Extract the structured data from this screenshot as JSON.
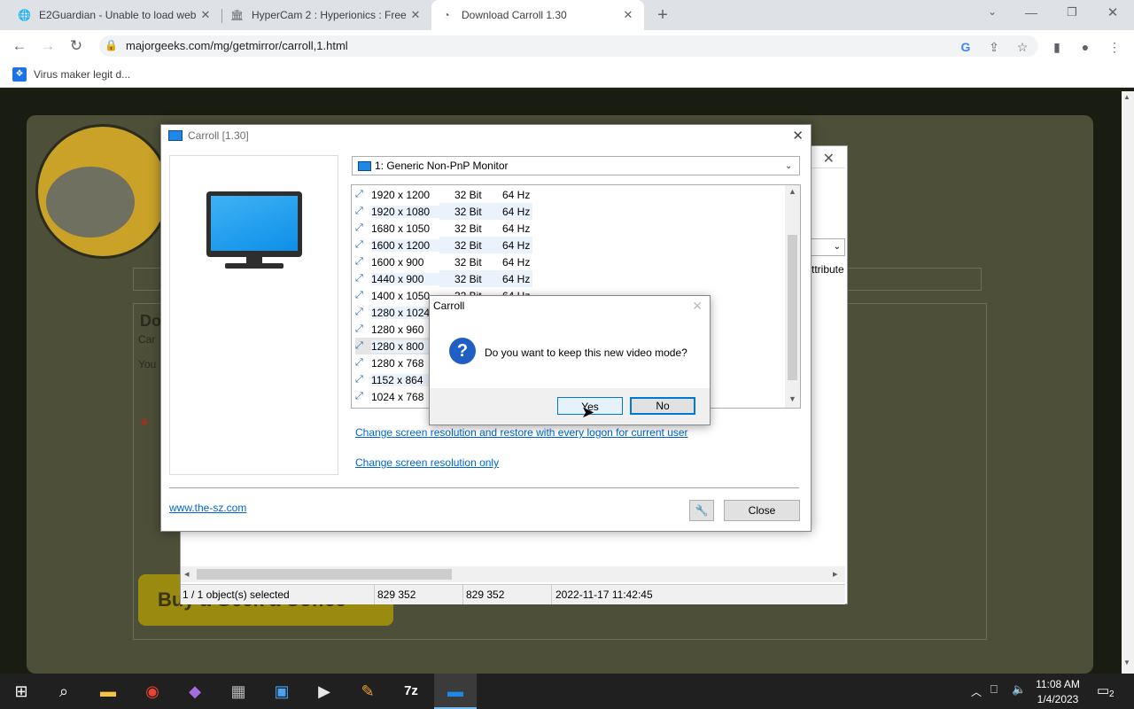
{
  "browser": {
    "tabs": [
      {
        "title": "E2Guardian - Unable to load web",
        "icon": "globe-icon"
      },
      {
        "title": "HyperCam 2 : Hyperionics : Free",
        "icon": "library-icon"
      },
      {
        "title": "Download Carroll 1.30",
        "icon": "spinner-icon"
      }
    ],
    "url": "majorgeeks.com/mg/getmirror/carroll,1.html",
    "bookmark": "Virus maker legit d..."
  },
  "bg_window": {
    "status_selected": "1 / 1 object(s) selected",
    "size1": "829 352",
    "size2": "829 352",
    "date": "2022-11-17 11:42:45",
    "partial_text": "ttribute"
  },
  "page": {
    "partial_heading": "Do",
    "partial_sub": "Car",
    "partial_text": "You",
    "coffee": "Buy a Geek a Coffee"
  },
  "carroll": {
    "title": "Carroll [1.30]",
    "monitor": "1: Generic Non-PnP Monitor",
    "modes": [
      {
        "res": "1920 x 1200",
        "bits": "32 Bit",
        "hz": "64 Hz"
      },
      {
        "res": "1920 x 1080",
        "bits": "32 Bit",
        "hz": "64 Hz"
      },
      {
        "res": "1680 x 1050",
        "bits": "32 Bit",
        "hz": "64 Hz"
      },
      {
        "res": "1600 x 1200",
        "bits": "32 Bit",
        "hz": "64 Hz"
      },
      {
        "res": "1600 x 900",
        "bits": "32 Bit",
        "hz": "64 Hz"
      },
      {
        "res": "1440 x 900",
        "bits": "32 Bit",
        "hz": "64 Hz"
      },
      {
        "res": "1400 x 1050",
        "bits": "32 Bit",
        "hz": "64 Hz"
      },
      {
        "res": "1280 x 1024",
        "bits": "",
        "hz": ""
      },
      {
        "res": "1280 x 960",
        "bits": "",
        "hz": ""
      },
      {
        "res": "1280 x 800",
        "bits": "",
        "hz": ""
      },
      {
        "res": "1280 x 768",
        "bits": "",
        "hz": ""
      },
      {
        "res": "1152 x 864",
        "bits": "",
        "hz": ""
      },
      {
        "res": "1024 x 768",
        "bits": "",
        "hz": ""
      }
    ],
    "link_restore": "Change screen resolution and restore with every logon for current user",
    "link_only": "Change screen resolution only",
    "website": "www.the-sz.com",
    "close": "Close"
  },
  "dialog": {
    "title": "Carroll",
    "message": "Do you want to keep this new video mode?",
    "yes": "Yes",
    "no": "No"
  },
  "taskbar": {
    "time": "11:08 AM",
    "date": "1/4/2023",
    "notifications": "2"
  }
}
